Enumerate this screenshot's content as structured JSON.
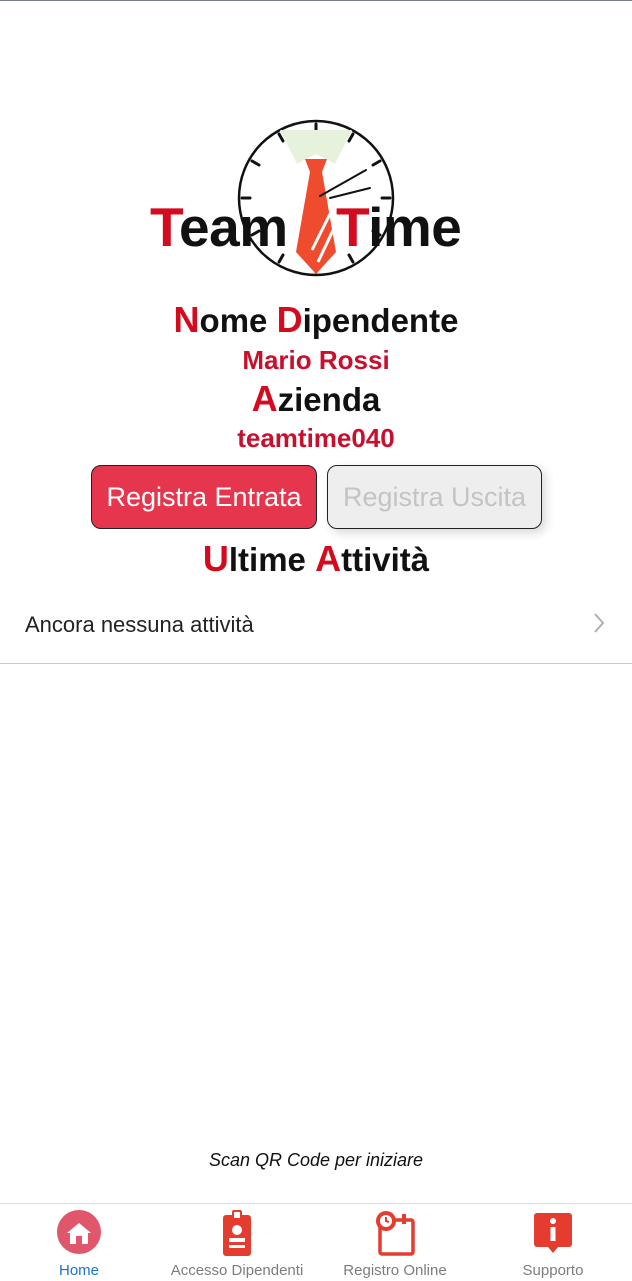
{
  "app": {
    "logo_word1_first": "T",
    "logo_word1_rest": "eam",
    "logo_word2_first": "T",
    "logo_word2_rest": "ime"
  },
  "employee": {
    "heading_cap": "N",
    "heading_rest1": "ome ",
    "heading_cap2": "D",
    "heading_rest2": "ipendente",
    "name": "Mario Rossi"
  },
  "company": {
    "heading_cap": "A",
    "heading_rest": "zienda",
    "name": "teamtime040"
  },
  "actions": {
    "check_in_label": "Registra Entrata",
    "check_out_label": "Registra Uscita"
  },
  "activities": {
    "heading_cap": "U",
    "heading_rest1": "ltime ",
    "heading_cap2": "A",
    "heading_rest2": "ttività",
    "empty_text": "Ancora nessuna attività"
  },
  "footer": {
    "scan_hint": "Scan QR Code per iniziare"
  },
  "tabs": [
    {
      "label": "Home",
      "icon": "home-icon",
      "active": true
    },
    {
      "label": "Accesso Dipendenti",
      "icon": "badge-icon",
      "active": false
    },
    {
      "label": "Registro Online",
      "icon": "calendar-clock-icon",
      "active": false
    },
    {
      "label": "Supporto",
      "icon": "info-icon",
      "active": false
    }
  ],
  "colors": {
    "brand_red": "#d40b1e",
    "button_red": "#e6364d",
    "tab_active": "#1a73c8"
  }
}
